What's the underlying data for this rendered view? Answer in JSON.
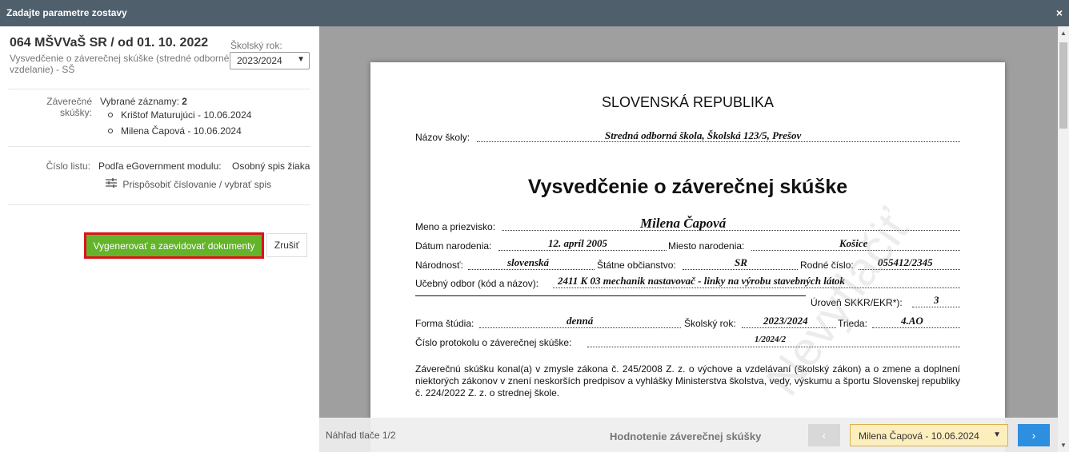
{
  "window": {
    "title": "Zadajte parametre zostavy",
    "close_icon": "×"
  },
  "left": {
    "report_code": "064 MŠVVaŠ SR / od 01. 10. 2022",
    "report_desc": "Vysvedčenie o záverečnej skúške (stredné odborné vzdelanie) - SŠ",
    "school_year_label": "Školský rok:",
    "school_year_value": "2023/2024",
    "exams_label": "Záverečné skúšky:",
    "selected_records_label": "Vybrané záznamy:",
    "selected_records_count": "2",
    "records": [
      "Krištof Maturujúci - 10.06.2024",
      "Milena Čapová - 10.06.2024"
    ],
    "sheet_number_label": "Číslo listu:",
    "sheet_number_value": "Podľa eGovernment modulu:",
    "sheet_file": "Osobný spis žiaka",
    "customize_label": "Prispôsobiť číslovanie / vybrať spis",
    "generate_button": "Vygenerovať a zaevidovať dokumenty",
    "cancel_button": "Zrušiť"
  },
  "preview": {
    "country": "SLOVENSKÁ REPUBLIKA",
    "school_label": "Názov školy:",
    "school_value": "Stredná odborná škola, Školská 123/5, Prešov",
    "heading": "Vysvedčenie o záverečnej skúške",
    "name_label": "Meno a priezvisko:",
    "name_value": "Milena Čapová",
    "birth_date_label": "Dátum narodenia:",
    "birth_date_value": "12. apríl 2005",
    "birth_place_label": "Miesto narodenia:",
    "birth_place_value": "Košice",
    "nationality_label": "Národnosť:",
    "nationality_value": "slovenská",
    "citizenship_label": "Štátne občianstvo:",
    "citizenship_value": "SR",
    "birth_number_label": "Rodné číslo:",
    "birth_number_value": "055412/2345",
    "field_label": "Učebný odbor (kód a názov):",
    "field_value": "2411 K 03 mechanik nastavovač - linky na výrobu stavebných látok",
    "level_label": "Úroveň SKKR/EKR*):",
    "level_value": "3",
    "study_form_label": "Forma štúdia:",
    "study_form_value": "denná",
    "school_year_label": "Školský rok:",
    "school_year_value": "2023/2024",
    "class_label": "Trieda:",
    "class_value": "4.AO",
    "protocol_label": "Číslo protokolu o záverečnej skúške:",
    "protocol_value": "1/2024/2",
    "paragraph": "Záverečnú skúšku konal(a) v zmysle zákona č. 245/2008 Z. z. o výchove a vzdelávaní (školský zákon) a o zmene a doplnení niektorých zákonov v znení neskorších predpisov a vyhlášky Ministerstva školstva, vedy, výskumu a športu Slovenskej republiky č. 224/2022 Z. z. o strednej škole.",
    "watermark": "Nevytlačiť"
  },
  "bottombar": {
    "page_label": "Náhľad tlače 1/2",
    "section_title": "Hodnotenie záverečnej skúšky",
    "prev_icon": "‹",
    "record_select": "Milena Čapová - 10.06.2024",
    "next_icon": "›"
  }
}
